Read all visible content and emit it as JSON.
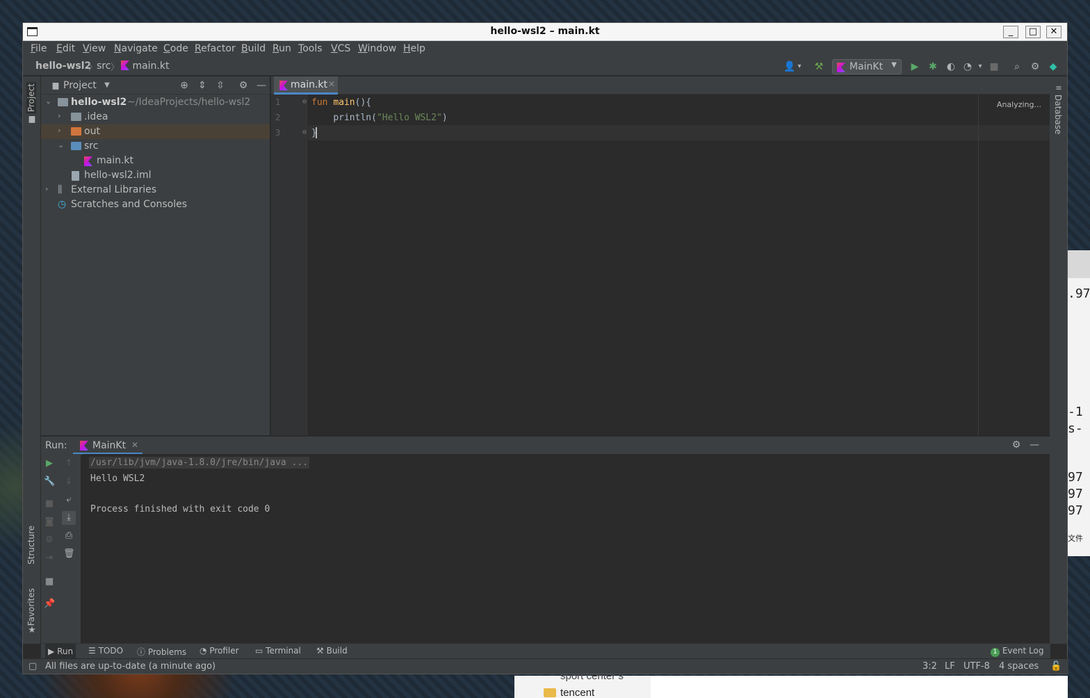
{
  "window": {
    "title": "hello-wsl2 – main.kt",
    "min_label": "_",
    "max_label": "□",
    "close_label": "✕"
  },
  "menu": [
    "File",
    "Edit",
    "View",
    "Navigate",
    "Code",
    "Refactor",
    "Build",
    "Run",
    "Tools",
    "VCS",
    "Window",
    "Help"
  ],
  "breadcrumb": {
    "project": "hello-wsl2",
    "folder": "src",
    "file": "main.kt"
  },
  "toolbar": {
    "run_config": "MainKt"
  },
  "left_stripe": {
    "project": "Project",
    "structure": "Structure",
    "favorites": "Favorites"
  },
  "right_stripe": {
    "database": "Database"
  },
  "project_panel": {
    "header": "Project",
    "tree": [
      {
        "label": "hello-wsl2",
        "path": "~/IdeaProjects/hello-wsl2"
      },
      {
        "label": ".idea"
      },
      {
        "label": "out"
      },
      {
        "label": "src"
      },
      {
        "label": "main.kt"
      },
      {
        "label": "hello-wsl2.iml"
      },
      {
        "label": "External Libraries"
      },
      {
        "label": "Scratches and Consoles"
      }
    ]
  },
  "editor": {
    "tab": "main.kt",
    "status": "Analyzing...",
    "line_numbers": [
      "1",
      "2",
      "3"
    ],
    "code": {
      "l1_kw": "fun",
      "l1_fn": "main",
      "l1_rest": "(){",
      "l2_fn": "println(",
      "l2_str": "\"Hello WSL2\"",
      "l2_rest": ")",
      "l3": "}"
    }
  },
  "run_panel": {
    "label": "Run:",
    "tab": "MainKt",
    "command": "/usr/lib/jvm/java-1.8.0/jre/bin/java ...",
    "output": [
      "Hello WSL2",
      "",
      "Process finished with exit code 0"
    ]
  },
  "bottom_tabs": [
    "Run",
    "TODO",
    "Problems",
    "Profiler",
    "Terminal",
    "Build"
  ],
  "event_log": {
    "badge": "1",
    "label": "Event Log"
  },
  "status": {
    "message": "All files are up-to-date (a minute ago)",
    "position": "3:2",
    "line_sep": "LF",
    "encoding": "UTF-8",
    "indent": "4 spaces"
  },
  "desktop": {
    "bottom_folder_label": "tencent",
    "bottom_folder_label_above": "sport center s",
    "side_text": [
      ".97",
      "-1",
      "s-",
      "97",
      "97",
      "97",
      "文件"
    ]
  }
}
